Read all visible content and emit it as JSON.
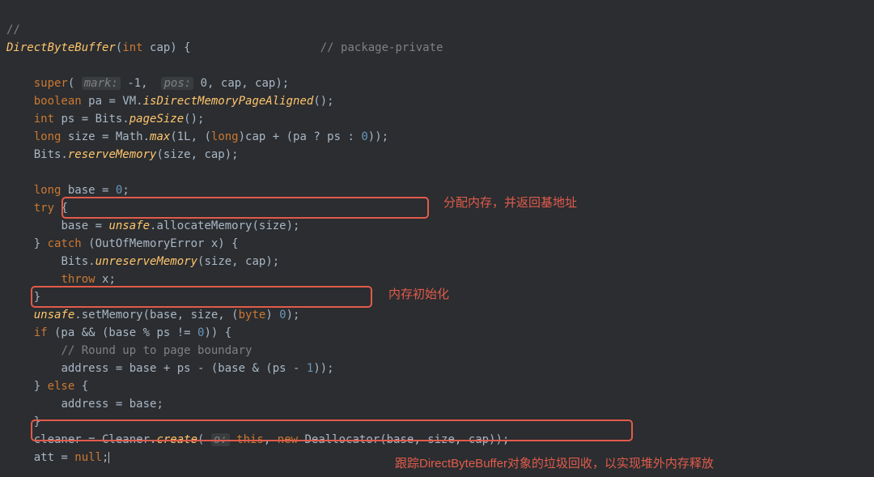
{
  "code": {
    "l0a": "// ",
    "l1": "DirectByteBuffer",
    "l1b": "(",
    "l1c": "int",
    "l1d": " cap) {                   ",
    "l1e": "// package-private",
    "l3a": "super",
    "l3b": "( ",
    "l3c": "mark:",
    "l3d": " -1,  ",
    "l3e": "pos:",
    "l3f": " 0, cap, cap);",
    "l4a": "boolean",
    "l4b": " pa = VM.",
    "l4c": "isDirectMemoryPageAligned",
    "l4d": "();",
    "l5a": "int",
    "l5b": " ps = Bits.",
    "l5c": "pageSize",
    "l5d": "();",
    "l6a": "long",
    "l6b": " size = Math.",
    "l6c": "max",
    "l6d": "(1L, (",
    "l6e": "long",
    "l6f": ")cap + (pa ? ps : ",
    "l6g": "0",
    "l6h": "));",
    "l7a": "Bits.",
    "l7b": "reserveMemory",
    "l7c": "(size, cap);",
    "l9a": "long",
    "l9b": " base = ",
    "l9c": "0",
    "l9d": ";",
    "l10a": "try",
    "l10b": " {",
    "l11a": "base = ",
    "l11b": "unsafe",
    "l11c": ".allocateMemory(size);",
    "l12a": "} ",
    "l12b": "catch",
    "l12c": " (OutOfMemoryError x) {",
    "l13a": "Bits.",
    "l13b": "unreserveMemory",
    "l13c": "(size, cap);",
    "l14a": "throw",
    "l14b": " x;",
    "l15a": "}",
    "l16a": "unsafe",
    "l16b": ".setMemory(base, size, (",
    "l16c": "byte",
    "l16d": ") ",
    "l16e": "0",
    "l16f": ");",
    "l17a": "if",
    "l17b": " (pa && (base % ps != ",
    "l17c": "0",
    "l17d": ")) {",
    "l18a": "// Round up to page boundary",
    "l19a": "address = base + ps - (base & (ps - ",
    "l19b": "1",
    "l19c": "));",
    "l20a": "} ",
    "l20b": "else",
    "l20c": " {",
    "l21a": "address = base;",
    "l22a": "}",
    "l23a": "cleaner = Cleaner.",
    "l23b": "create",
    "l23c": "( ",
    "l23d": "o:",
    "l23e": " ",
    "l23f": "this",
    "l23g": ", ",
    "l23h": "new",
    "l23i": " Deallocator(base, size, cap));",
    "l24a": "att = ",
    "l24b": "null",
    "l24c": ";"
  },
  "annotations": {
    "a1": "分配内存，并返回基地址",
    "a2": "内存初始化",
    "a3": "跟踪DirectByteBuffer对象的垃圾回收，以实现堆外内存释放"
  }
}
